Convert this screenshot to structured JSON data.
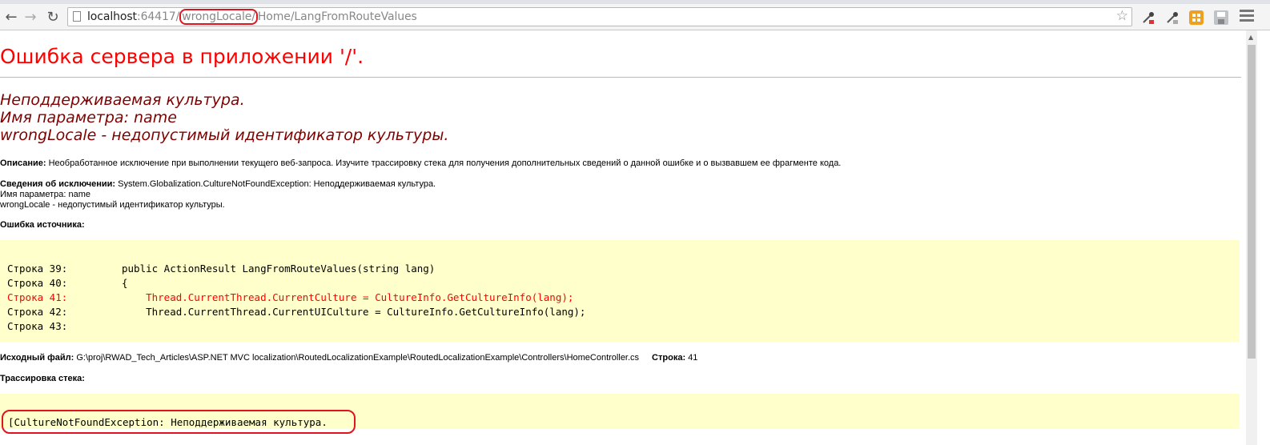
{
  "browser": {
    "back_icon": "←",
    "forward_icon": "→",
    "reload_icon": "↻",
    "url_host": "localhost",
    "url_port": ":64417/",
    "url_locale": "wrongLocale/",
    "url_rest": "Home/LangFromRouteValues",
    "star_icon": "☆"
  },
  "page": {
    "title": "Ошибка сервера в приложении '/'.",
    "message_lines": [
      "Неподдерживаемая культура.",
      "Имя параметра: name",
      "wrongLocale - недопустимый идентификатор культуры."
    ],
    "description_label": "Описание:",
    "description_text": " Необработанное исключение при выполнении текущего веб-запроса. Изучите трассировку стека для получения дополнительных сведений о данной ошибке и о вызвавшем ее фрагменте кода.",
    "exception_label": "Сведения об исключении:",
    "exception_text": " System.Globalization.CultureNotFoundException: Неподдерживаемая культура.",
    "exception_line2": "Имя параметра: name",
    "exception_line3": "wrongLocale - недопустимый идентификатор культуры.",
    "source_error_label": "Ошибка источника:",
    "source_lines": [
      {
        "text": "Строка 39:         public ActionResult LangFromRouteValues(string lang)",
        "highlight": false
      },
      {
        "text": "Строка 40:         {",
        "highlight": false
      },
      {
        "text": "Строка 41:             Thread.CurrentThread.CurrentCulture = CultureInfo.GetCultureInfo(lang);",
        "highlight": true
      },
      {
        "text": "Строка 42:             Thread.CurrentThread.CurrentUICulture = CultureInfo.GetCultureInfo(lang);",
        "highlight": false
      },
      {
        "text": "Строка 43:",
        "highlight": false
      }
    ],
    "source_file_label": "Исходный файл:",
    "source_file_path": " G:\\proj\\RWAD_Tech_Articles\\ASP.NET MVC localization\\RoutedLocalizationExample\\RoutedLocalizationExample\\Controllers\\HomeController.cs",
    "line_label": "Строка:",
    "line_number": " 41",
    "stack_trace_label": "Трассировка стека:",
    "stack_first_line": "[CultureNotFoundException: Неподдерживаемая культура."
  }
}
